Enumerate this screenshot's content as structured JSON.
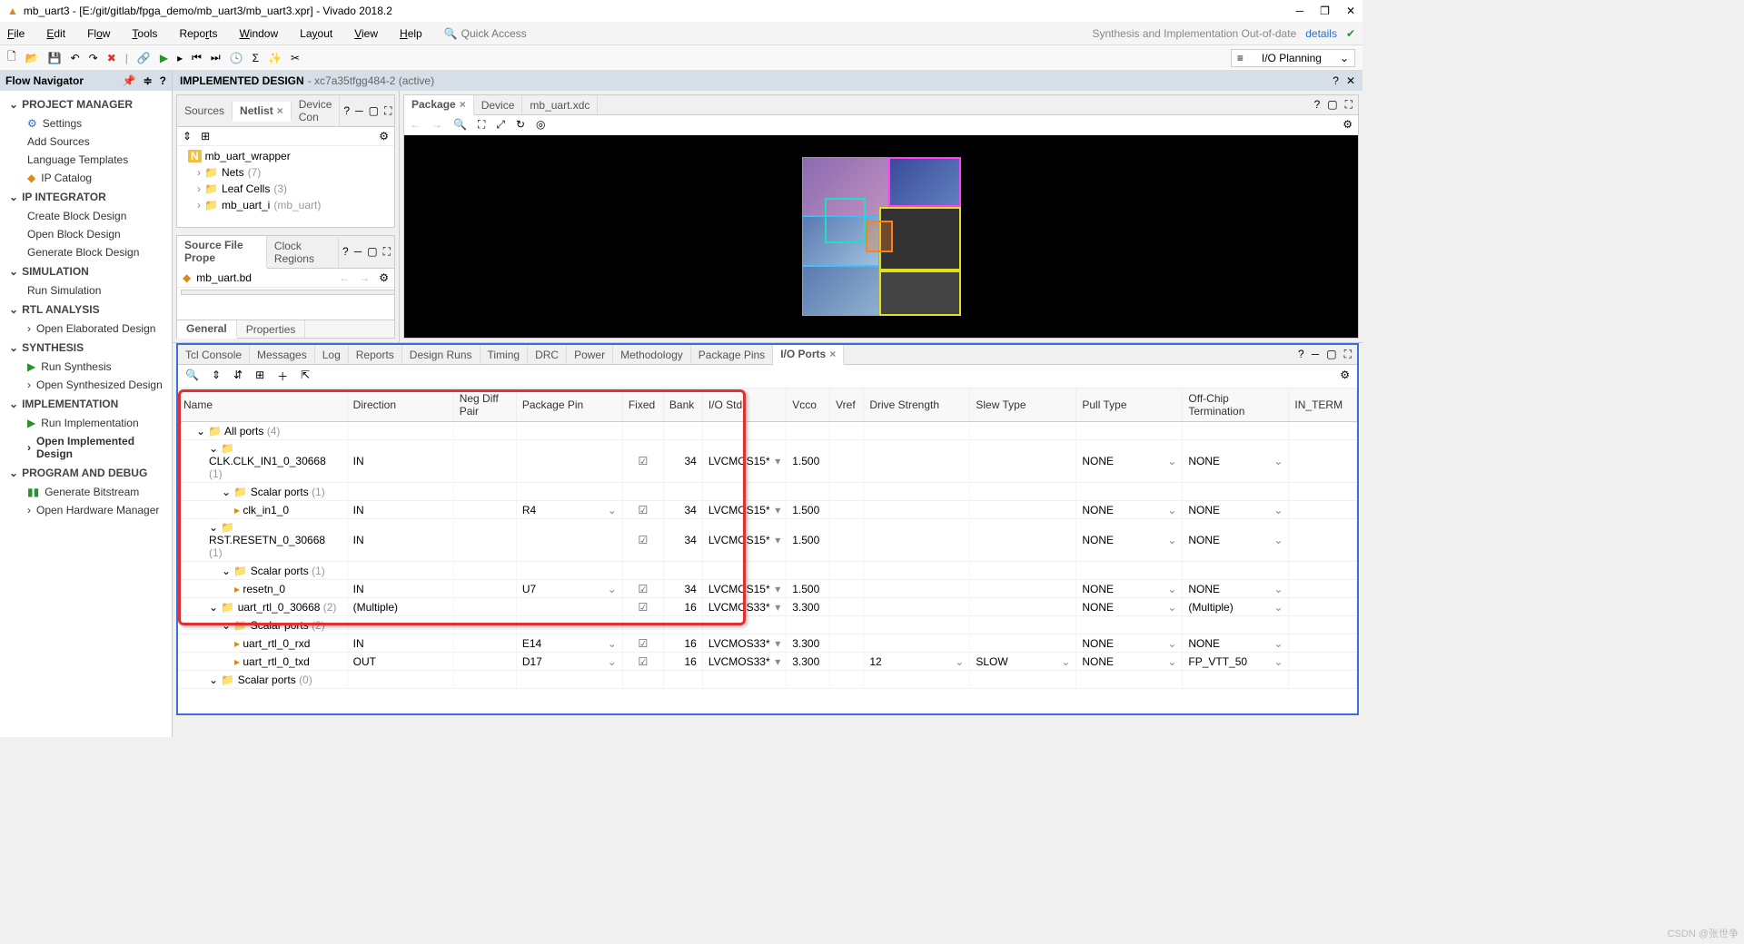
{
  "window": {
    "title": "mb_uart3 - [E:/git/gitlab/fpga_demo/mb_uart3/mb_uart3.xpr] - Vivado 2018.2"
  },
  "menu": {
    "file": "File",
    "edit": "Edit",
    "flow": "Flow",
    "tools": "Tools",
    "reports": "Reports",
    "window": "Window",
    "layout": "Layout",
    "view": "View",
    "help": "Help"
  },
  "search": {
    "placeholder": "Quick Access"
  },
  "status": {
    "warn": "Synthesis and Implementation Out-of-date",
    "details": "details"
  },
  "layout_dd": "I/O Planning",
  "flow_nav": {
    "title": "Flow Navigator",
    "sections": [
      {
        "label": "PROJECT MANAGER",
        "items": [
          {
            "l": "Settings",
            "icon": "gear"
          },
          {
            "l": "Add Sources"
          },
          {
            "l": "Language Templates"
          },
          {
            "l": "IP Catalog",
            "icon": "ip"
          }
        ]
      },
      {
        "label": "IP INTEGRATOR",
        "items": [
          {
            "l": "Create Block Design"
          },
          {
            "l": "Open Block Design"
          },
          {
            "l": "Generate Block Design"
          }
        ]
      },
      {
        "label": "SIMULATION",
        "items": [
          {
            "l": "Run Simulation"
          }
        ]
      },
      {
        "label": "RTL ANALYSIS",
        "items": [
          {
            "l": "Open Elaborated Design",
            "arrow": true
          }
        ]
      },
      {
        "label": "SYNTHESIS",
        "items": [
          {
            "l": "Run Synthesis",
            "icon": "play"
          },
          {
            "l": "Open Synthesized Design",
            "arrow": true
          }
        ]
      },
      {
        "label": "IMPLEMENTATION",
        "bold": true,
        "items": [
          {
            "l": "Run Implementation",
            "icon": "play"
          },
          {
            "l": "Open Implemented Design",
            "arrow": true,
            "bold": true
          }
        ]
      },
      {
        "label": "PROGRAM AND DEBUG",
        "items": [
          {
            "l": "Generate Bitstream",
            "icon": "bit"
          },
          {
            "l": "Open Hardware Manager",
            "arrow": true
          }
        ]
      }
    ]
  },
  "impl_header": {
    "title": "IMPLEMENTED DESIGN",
    "sub": "- xc7a35tfgg484-2  (active)"
  },
  "netlist": {
    "tabs": [
      "Sources",
      "Netlist",
      "Device Con"
    ],
    "active": 1,
    "root": "mb_uart_wrapper",
    "nodes": [
      {
        "l": "Nets",
        "c": "(7)"
      },
      {
        "l": "Leaf Cells",
        "c": "(3)"
      },
      {
        "l": "mb_uart_i",
        "c": "(mb_uart)"
      }
    ]
  },
  "props": {
    "tabs": [
      "Source File Prope",
      "Clock Regions"
    ],
    "active": 0,
    "file": "mb_uart.bd",
    "bottom_tabs": [
      "General",
      "Properties"
    ],
    "bottom_active": 0
  },
  "device_tabs": {
    "tabs": [
      "Package",
      "Device",
      "mb_uart.xdc"
    ],
    "active": 0
  },
  "bottom_tabs": {
    "tabs": [
      "Tcl Console",
      "Messages",
      "Log",
      "Reports",
      "Design Runs",
      "Timing",
      "DRC",
      "Power",
      "Methodology",
      "Package Pins",
      "I/O Ports"
    ],
    "active": 10
  },
  "io_cols": [
    "Name",
    "Direction",
    "Neg Diff Pair",
    "Package Pin",
    "Fixed",
    "Bank",
    "I/O Std",
    "Vcco",
    "Vref",
    "Drive Strength",
    "Slew Type",
    "Pull Type",
    "Off-Chip Termination",
    "IN_TERM"
  ],
  "io_rows": [
    {
      "ind": 1,
      "name": "All ports",
      "cnt": "(4)"
    },
    {
      "ind": 2,
      "name": "CLK.CLK_IN1_0_30668",
      "cnt": "(1)",
      "dir": "IN",
      "fixed": true,
      "bank": "34",
      "std": "LVCMOS15*",
      "vcco": "1.500",
      "pull": "NONE",
      "off": "NONE"
    },
    {
      "ind": 3,
      "name": "Scalar ports",
      "cnt": "(1)"
    },
    {
      "ind": 4,
      "name": "clk_in1_0",
      "port": true,
      "dir": "IN",
      "pin": "R4",
      "fixed": true,
      "bank": "34",
      "std": "LVCMOS15*",
      "vcco": "1.500",
      "pull": "NONE",
      "off": "NONE"
    },
    {
      "ind": 2,
      "name": "RST.RESETN_0_30668",
      "cnt": "(1)",
      "dir": "IN",
      "fixed": true,
      "bank": "34",
      "std": "LVCMOS15*",
      "vcco": "1.500",
      "pull": "NONE",
      "off": "NONE"
    },
    {
      "ind": 3,
      "name": "Scalar ports",
      "cnt": "(1)"
    },
    {
      "ind": 4,
      "name": "resetn_0",
      "port": true,
      "dir": "IN",
      "pin": "U7",
      "fixed": true,
      "bank": "34",
      "std": "LVCMOS15*",
      "vcco": "1.500",
      "pull": "NONE",
      "off": "NONE"
    },
    {
      "ind": 2,
      "name": "uart_rtl_0_30668",
      "cnt": "(2)",
      "dir": "(Multiple)",
      "fixed": true,
      "bank": "16",
      "std": "LVCMOS33*",
      "vcco": "3.300",
      "pull": "NONE",
      "off": "(Multiple)"
    },
    {
      "ind": 3,
      "name": "Scalar ports",
      "cnt": "(2)"
    },
    {
      "ind": 4,
      "name": "uart_rtl_0_rxd",
      "port": true,
      "dir": "IN",
      "pin": "E14",
      "fixed": true,
      "bank": "16",
      "std": "LVCMOS33*",
      "vcco": "3.300",
      "pull": "NONE",
      "off": "NONE"
    },
    {
      "ind": 4,
      "name": "uart_rtl_0_txd",
      "port": true,
      "out": true,
      "dir": "OUT",
      "pin": "D17",
      "fixed": true,
      "bank": "16",
      "std": "LVCMOS33*",
      "vcco": "3.300",
      "drive": "12",
      "slew": "SLOW",
      "pull": "NONE",
      "off": "FP_VTT_50"
    },
    {
      "ind": 2,
      "name": "Scalar ports",
      "cnt": "(0)"
    }
  ],
  "watermark": "CSDN @张世争"
}
